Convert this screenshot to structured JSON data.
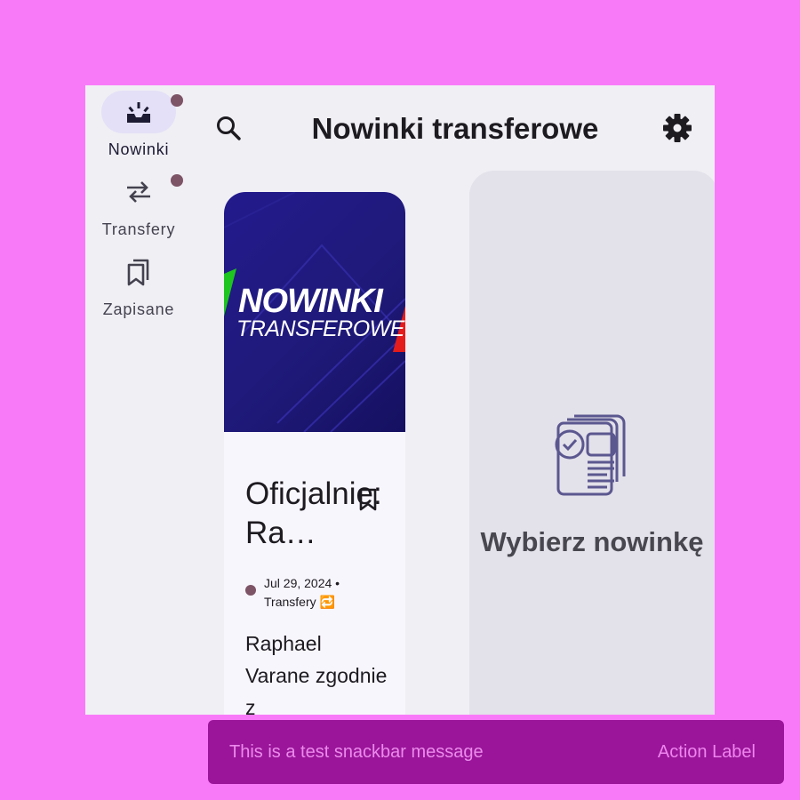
{
  "app": {
    "title": "Nowinki transferowe"
  },
  "nav": {
    "items": [
      {
        "label": "Nowinki",
        "icon": "inbox-icon",
        "active": true,
        "badge": true
      },
      {
        "label": "Transfery",
        "icon": "swap-arrows-icon",
        "active": false,
        "badge": true
      },
      {
        "label": "Zapisane",
        "icon": "bookmarks-icon",
        "active": false,
        "badge": false
      }
    ]
  },
  "toolbar": {
    "search_icon": "search-icon",
    "settings_icon": "gear-icon"
  },
  "card": {
    "hero_line1": "NOWINKI",
    "hero_line2": "TRANSFEROWE",
    "title": "Oficjalnie: Ra…",
    "date": "Jul 29, 2024 •",
    "category": "Transfery 🔁",
    "body": "Raphael Varane zgodnie z"
  },
  "detail": {
    "placeholder": "Wybierz nowinkę"
  },
  "snackbar": {
    "message": "This is a test snackbar message",
    "action": "Action Label"
  },
  "colors": {
    "background": "#f97af9",
    "surface": "#f0eff4",
    "accent_badge": "#7d5366",
    "snackbar": "#9a159a"
  }
}
